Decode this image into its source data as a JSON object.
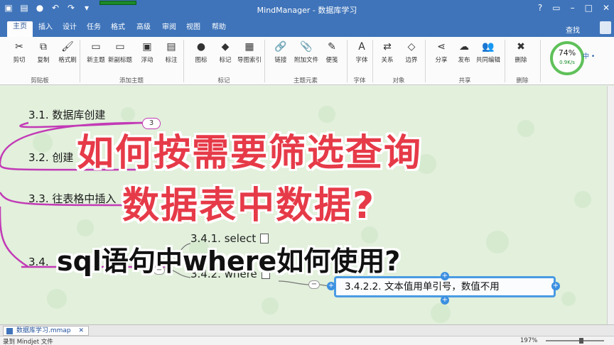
{
  "window": {
    "title": "MindManager - 数据库学习"
  },
  "ribbon_tabs": [
    "主页",
    "插入",
    "设计",
    "任务",
    "格式",
    "高级",
    "审阅",
    "视图",
    "帮助"
  ],
  "active_tab": "主页",
  "search_label": "查找",
  "ribbon": {
    "buttons": [
      {
        "label": "剪切",
        "icon": "scissors-icon",
        "glyph": "✂"
      },
      {
        "label": "复制",
        "icon": "copy-icon",
        "glyph": "⧉"
      },
      {
        "label": "格式刷",
        "icon": "format-brush-icon",
        "glyph": "🖌"
      },
      {
        "label": "新主题",
        "icon": "new-topic-icon",
        "glyph": "▭"
      },
      {
        "label": "新副标题",
        "icon": "new-subtopic-icon",
        "glyph": "▭"
      },
      {
        "label": "浮动",
        "icon": "floating-topic-icon",
        "glyph": "▣"
      },
      {
        "label": "标注",
        "icon": "callout-icon",
        "glyph": "▤"
      },
      {
        "label": "图标",
        "icon": "icon-marker-icon",
        "glyph": "●"
      },
      {
        "label": "标记",
        "icon": "tag-icon",
        "glyph": "◆"
      },
      {
        "label": "导图索引",
        "icon": "map-index-icon",
        "glyph": "▦"
      },
      {
        "label": "链接",
        "icon": "link-icon",
        "glyph": "🔗"
      },
      {
        "label": "附加文件",
        "icon": "attachment-icon",
        "glyph": "📎"
      },
      {
        "label": "便笺",
        "icon": "notes-icon",
        "glyph": "✎"
      },
      {
        "label": "字体",
        "icon": "font-icon",
        "glyph": "A"
      },
      {
        "label": "关系",
        "icon": "relationship-icon",
        "glyph": "⇄"
      },
      {
        "label": "边界",
        "icon": "boundary-icon",
        "glyph": "◇"
      },
      {
        "label": "分享",
        "icon": "share-icon",
        "glyph": "⋖"
      },
      {
        "label": "发布",
        "icon": "publish-icon",
        "glyph": "☁"
      },
      {
        "label": "共同编辑",
        "icon": "coedit-icon",
        "glyph": "👥"
      },
      {
        "label": "删除",
        "icon": "delete-icon",
        "glyph": "✖"
      }
    ],
    "groups": [
      "剪贴板",
      "添加主题",
      "标记",
      "主题元素",
      "字体",
      "对象",
      "共享",
      "删除"
    ]
  },
  "gauge": {
    "percent": "74%",
    "speed": "0.9K/s",
    "side": "中 •"
  },
  "mindmap": {
    "topics": [
      "3.1. 数据库创建",
      "3.2. 创建",
      "3.3. 往表格中插入",
      "3.4."
    ],
    "subtopics": [
      "3.4.1. select",
      "3.4.2. where"
    ],
    "selected_topic": "3.4.2.2. 文本值用单引号，数值不用",
    "collapsed_count": "3"
  },
  "overlay": {
    "headline_line1": "如何按需要筛选查询",
    "headline_line2": "数据表中数据?",
    "subhead": "sql语句中where如何使用?"
  },
  "document_tab": "数据库学习.mmap",
  "status": {
    "left_text": "录到 Mindjet 文件",
    "zoom": "197%",
    "zoom_fraction": 0.62
  },
  "colors": {
    "titlebar": "#3f74ba",
    "headline": "#e63a48",
    "branch": "#c23ab6",
    "selection": "#4a9be3"
  }
}
